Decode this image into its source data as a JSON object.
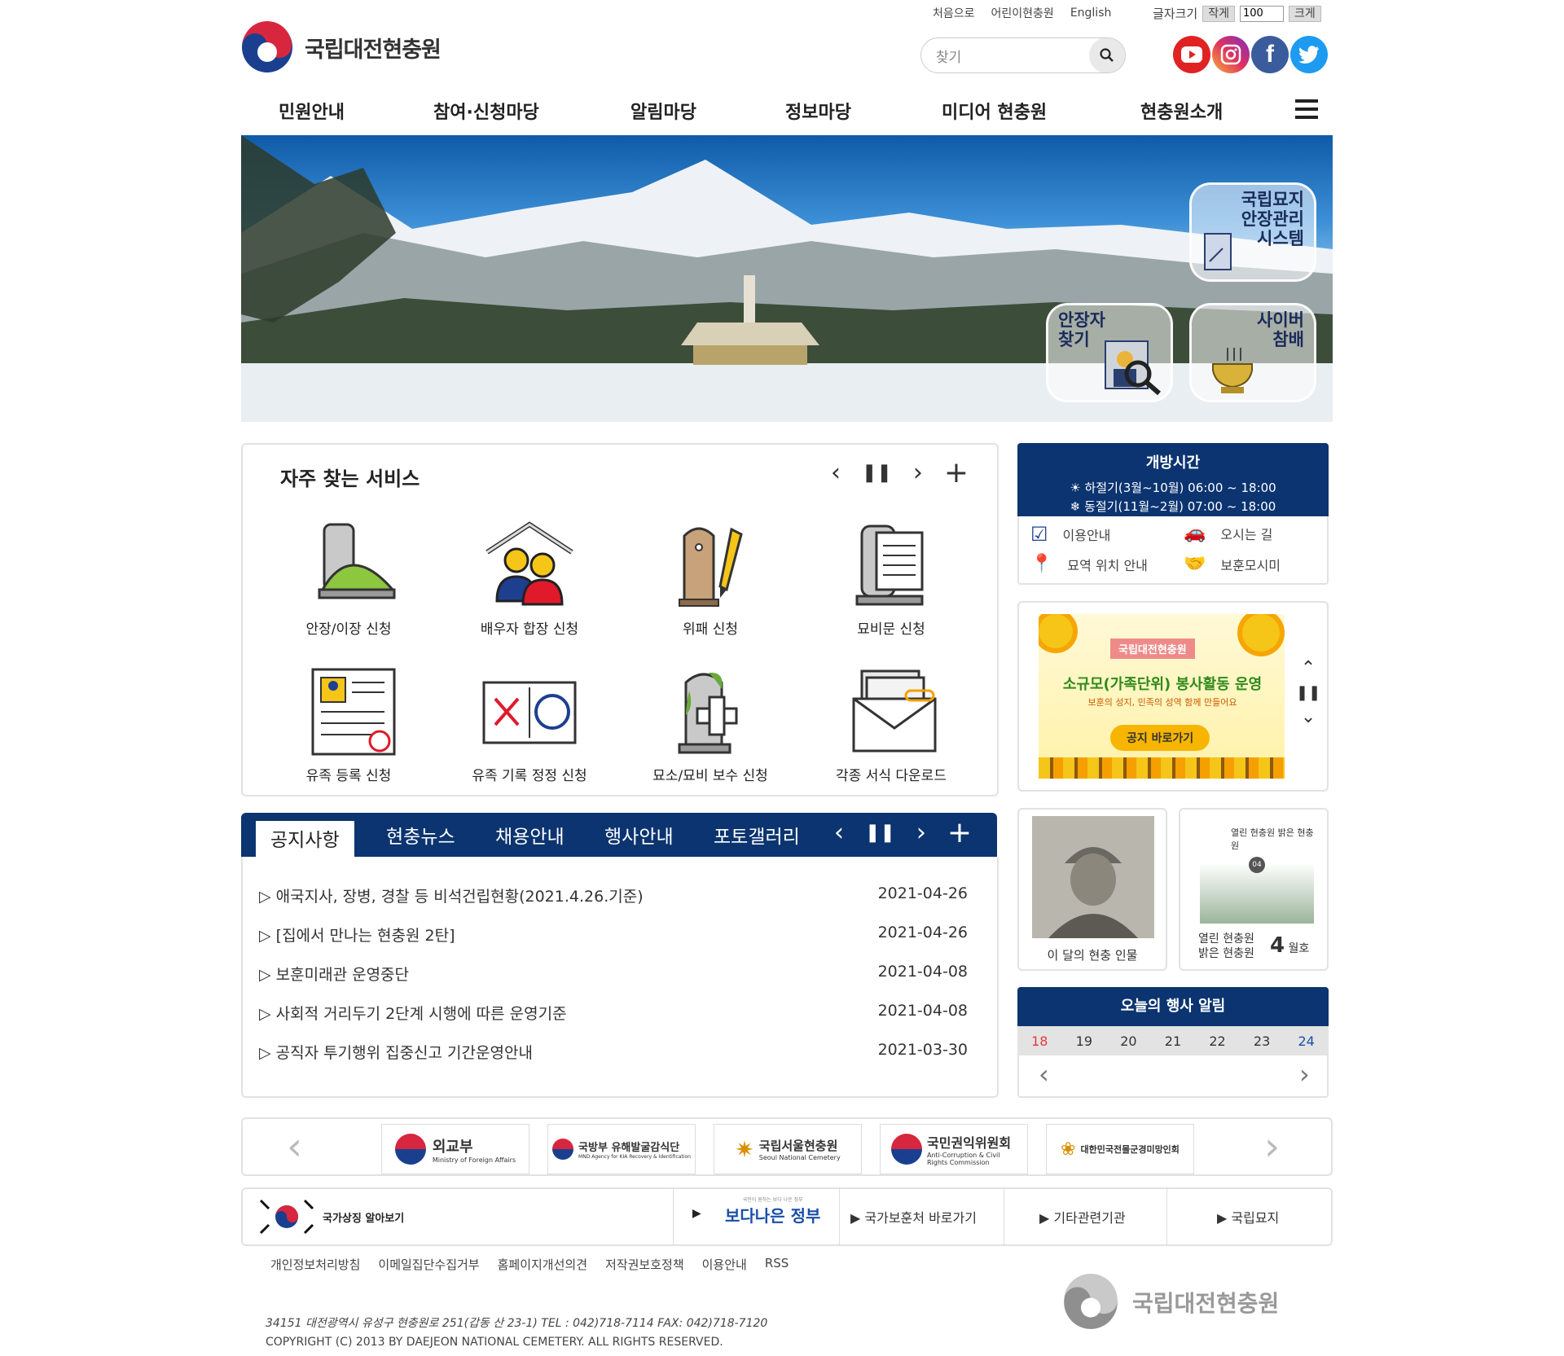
{
  "util": {
    "home": "처음으로",
    "kids": "어린이현충원",
    "english": "English",
    "fontsize_label": "글자크기",
    "smaller": "작게",
    "size_value": "100",
    "bigger": "크게"
  },
  "logo": {
    "name": "국립대전현충원"
  },
  "search": {
    "placeholder": "찾기"
  },
  "nav": [
    "민원안내",
    "참여·신청마당",
    "알림마당",
    "정보마당",
    "미디어 현충원",
    "현충원소개"
  ],
  "hero": {
    "grave_system": [
      "국립묘지",
      "안장관리",
      "시스템"
    ],
    "find": [
      "안장자",
      "찾기"
    ],
    "cyber": [
      "사이버",
      "참배"
    ]
  },
  "services": {
    "title": "자주 찾는 서비스",
    "items": [
      "안장/이장 신청",
      "배우자 합장 신청",
      "위패 신청",
      "묘비문 신청",
      "유족 등록 신청",
      "유족 기록 정정 신청",
      "묘소/묘비 보수 신청",
      "각종 서식 다운로드"
    ]
  },
  "hours": {
    "title": "개방시간",
    "summer": "하절기(3월~10월) 06:00 ~ 18:00",
    "winter": "동절기(11월~2월) 07:00 ~ 18:00"
  },
  "quicklinks": [
    "이용안내",
    "오시는 길",
    "묘역 위치 안내",
    "보훈모시미"
  ],
  "banner": {
    "tag": "국립대전현충원",
    "headline": "소규모(가족단위) 봉사활동 운영",
    "sub": "보훈의 성지, 민족의 성역 함께 만들어요",
    "cta": "공지 바로가기"
  },
  "notice": {
    "tabs": [
      "공지사항",
      "현충뉴스",
      "채용안내",
      "행사안내",
      "포토갤러리"
    ],
    "rows": [
      {
        "title": "애국지사, 장병, 경찰 등 비석건립현황(2021.4.26.기준)",
        "date": "2021-04-26"
      },
      {
        "title": "[집에서 만나는 현충원 2탄]",
        "date": "2021-04-26"
      },
      {
        "title": "보훈미래관 운영중단",
        "date": "2021-04-08"
      },
      {
        "title": "사회적 거리두기 2단계 시행에 따른 운영기준",
        "date": "2021-04-08"
      },
      {
        "title": "공직자 투기행위 집중신고 기간운영안내",
        "date": "2021-03-30"
      }
    ]
  },
  "person": {
    "label": "이 달의 현충 인물"
  },
  "magazine": {
    "line1": "열린 현충원",
    "line2": "밝은 현충원",
    "month_num": "4",
    "month_unit": "월호",
    "cover_title": "열린 현충원 밝은 현충원",
    "cover_no": "04"
  },
  "events": {
    "title": "오늘의 행사 알림",
    "days": [
      "18",
      "19",
      "20",
      "21",
      "22",
      "23",
      "24"
    ]
  },
  "partners": [
    {
      "name": "외교부",
      "sub": "Ministry of Foreign Affairs"
    },
    {
      "name": "국방부 유해발굴감식단",
      "sub": "MND Agency for KIA Recovery & Identification"
    },
    {
      "name": "국립서울현충원",
      "sub": "Seoul National Cemetery"
    },
    {
      "name": "국민권익위원회",
      "sub": "Anti-Corruption & Civil Rights Commission"
    },
    {
      "name": "대한민국전몰군경미망인회",
      "sub": ""
    }
  ],
  "bottom_links": {
    "symbol": "국가상징 알아보기",
    "better": "보다나은 정부",
    "better_small": "국민이 원하는 보다 나은 정부",
    "mpva": "국가보훈처 바로가기",
    "others": "기타관련기관",
    "cemetery": "국립묘지"
  },
  "footer": {
    "links": [
      "개인정보처리방침",
      "이메일집단수집거부",
      "홈페이지개선의견",
      "저작권보호정책",
      "이용안내",
      "RSS"
    ],
    "address": "34151 대전광역시 유성구 현충원로 251(갑동 산 23-1) TEL : 042)718-7114 FAX: 042)718-7120",
    "copyright": "COPYRIGHT (C) 2013 BY DAEJEON NATIONAL CEMETERY. ALL RIGHTS RESERVED.",
    "logo": "국립대전현충원"
  },
  "colors": {
    "navy": "#0b3470",
    "red": "#e23b3b",
    "blue": "#1a4ea8"
  }
}
